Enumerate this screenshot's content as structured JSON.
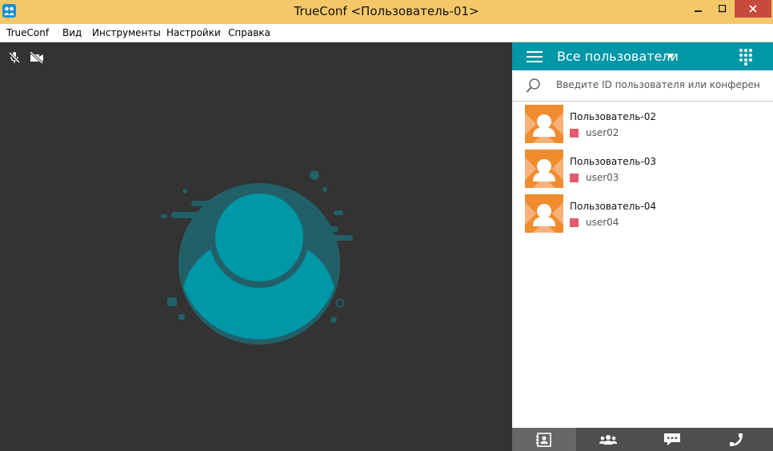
{
  "window": {
    "title": "TrueConf <Пользователь-01>"
  },
  "menu": [
    "TrueConf",
    "Вид",
    "Инструменты",
    "Настройки",
    "Справка"
  ],
  "panel": {
    "filter_label": "Все пользователи",
    "search_placeholder": "Введите ID пользователя или конференции"
  },
  "contacts": [
    {
      "name": "Пользователь-02",
      "login": "user02",
      "status": "offline"
    },
    {
      "name": "Пользователь-03",
      "login": "user03",
      "status": "offline"
    },
    {
      "name": "Пользователь-04",
      "login": "user04",
      "status": "offline"
    }
  ],
  "bottom_tabs": [
    {
      "icon": "address-book-icon",
      "active": true
    },
    {
      "icon": "group-icon",
      "active": false
    },
    {
      "icon": "chat-icon",
      "active": false
    },
    {
      "icon": "phone-icon",
      "active": false
    }
  ],
  "colors": {
    "titlebar": "#f4c869",
    "accent": "#0097a7",
    "video_bg": "#333333",
    "status_offline": "#e35a6e",
    "avatar_orange": "#f08c2e"
  }
}
